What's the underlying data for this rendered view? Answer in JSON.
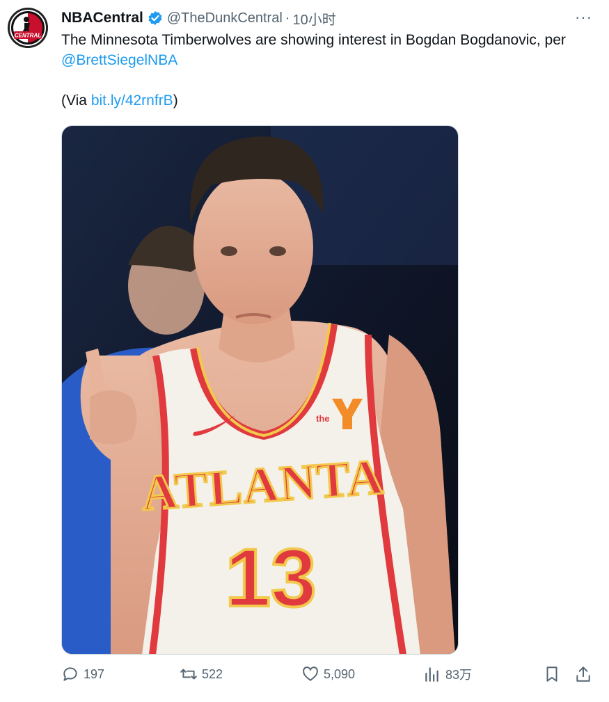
{
  "tweet": {
    "author_name": "NBACentral",
    "handle": "@TheDunkCentral",
    "separator": "·",
    "time": "10小时",
    "more": "···",
    "text_main": "The Minnesota Timberwolves are showing interest in Bogdan Bogdanovic, per ",
    "mention": "@BrettSiegelNBA",
    "via_prefix": "(Via ",
    "via_link": "bit.ly/42rnfrB",
    "via_suffix": ")",
    "avatar_text": "CENTRAL"
  },
  "media": {
    "jersey_city": "ATLANTA",
    "jersey_number": "13",
    "jersey_logo_text": "the"
  },
  "actions": {
    "replies": "197",
    "retweets": "522",
    "likes": "5,090",
    "views": "83万"
  },
  "colors": {
    "link": "#1d9bf0",
    "verified": "#1d9bf0",
    "jersey_red": "#e03a3e",
    "jersey_yellow": "#f2c94c",
    "icon_gray": "#536471"
  }
}
